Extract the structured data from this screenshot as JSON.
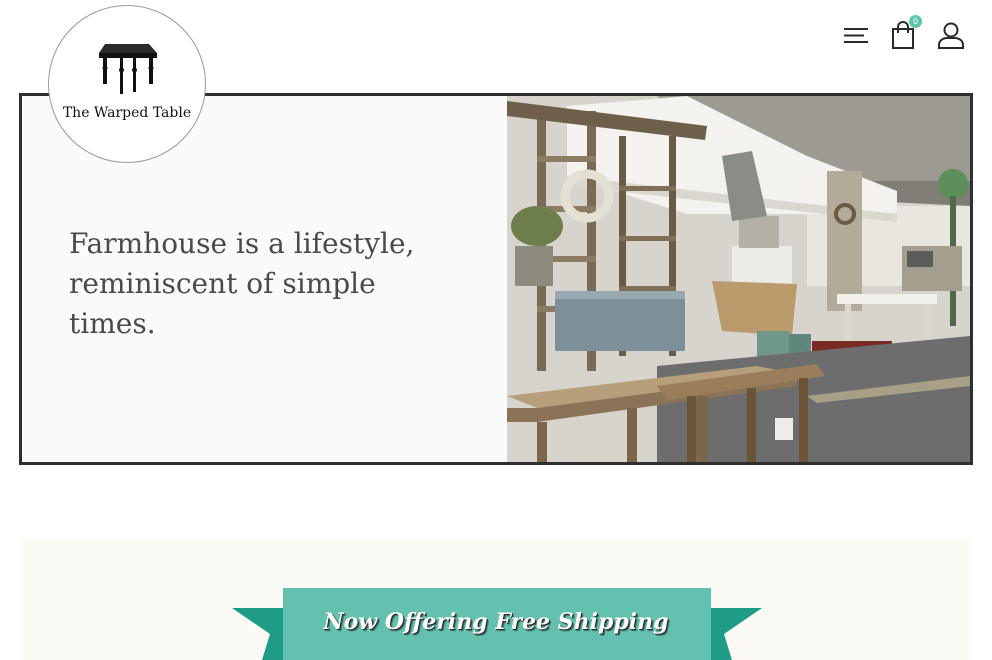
{
  "brand": {
    "name": "The Warped Table"
  },
  "header": {
    "cart_count": "0"
  },
  "hero": {
    "headline": "Farmhouse is a lifestyle, reminiscent of simple times."
  },
  "promo": {
    "ribbon_text": "Now Offering Free Shipping"
  },
  "colors": {
    "accent": "#5ec4b0",
    "ribbon": "#64c1b0",
    "ribbon_tail": "#1e9c85",
    "frame": "#2f2f2f",
    "text": "#4a4a4a"
  },
  "icons": [
    "menu-icon",
    "cart-icon",
    "account-icon"
  ]
}
